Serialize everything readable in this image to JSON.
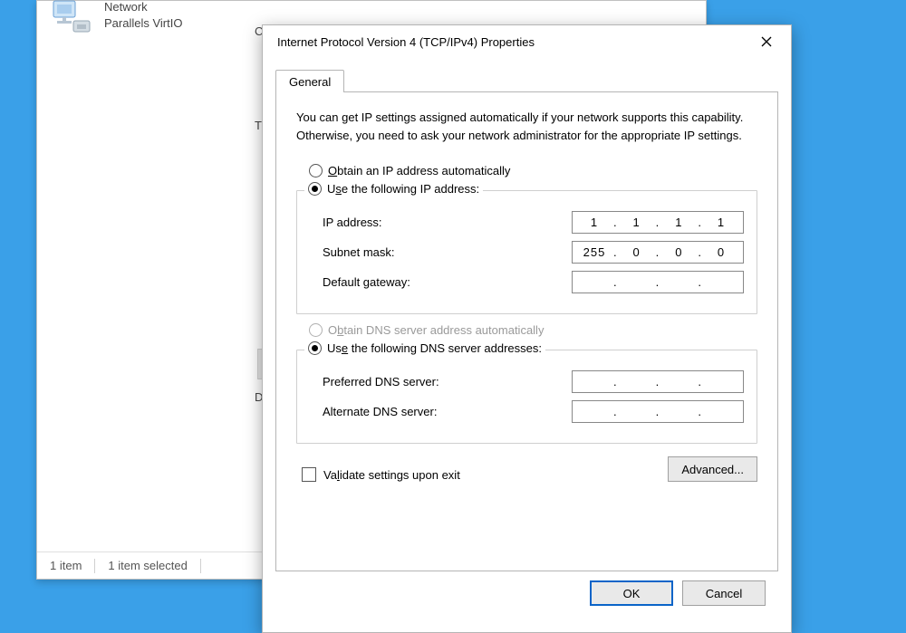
{
  "background": {
    "network_item": {
      "line1": "Network",
      "line2": "Parallels VirtIO"
    },
    "connect_label_fragment": "Co",
    "th_label": "Th",
    "d_label": "D",
    "status_bar": {
      "items_count": "1 item",
      "selected": "1 item selected"
    }
  },
  "dialog": {
    "title": "Internet Protocol Version 4 (TCP/IPv4) Properties",
    "tab_general": "General",
    "description": "You can get IP settings assigned automatically if your network supports this capability. Otherwise, you need to ask your network administrator for the appropriate IP settings.",
    "ip_section": {
      "radio_auto": "Obtain an IP address automatically",
      "radio_manual_prefix": "Use the following IP address:",
      "radio_manual_ul": "S",
      "fields": {
        "ip_address": {
          "label": "IP address:",
          "ul": "I",
          "octets": [
            "1",
            "1",
            "1",
            "1"
          ]
        },
        "subnet_mask": {
          "label": "Subnet mask:",
          "ul": "u",
          "octets": [
            "255",
            "0",
            "0",
            "0"
          ]
        },
        "default_gateway": {
          "label": "Default gateway:",
          "ul": "D",
          "octets": [
            "",
            "",
            "",
            ""
          ]
        }
      }
    },
    "dns_section": {
      "radio_auto": "Obtain DNS server address automatically",
      "radio_auto_ul": "b",
      "radio_manual": "Use the following DNS server addresses:",
      "radio_manual_ul": "e",
      "fields": {
        "preferred": {
          "label": "Preferred DNS server:",
          "ul": "P",
          "octets": [
            "",
            "",
            "",
            ""
          ]
        },
        "alternate": {
          "label": "Alternate DNS server:",
          "ul": "A",
          "octets": [
            "",
            "",
            "",
            ""
          ]
        }
      }
    },
    "validate_label": "Validate settings upon exit",
    "validate_ul": "l",
    "advanced_button": "Advanced...",
    "advanced_ul": "V",
    "ok_button": "OK",
    "cancel_button": "Cancel"
  }
}
